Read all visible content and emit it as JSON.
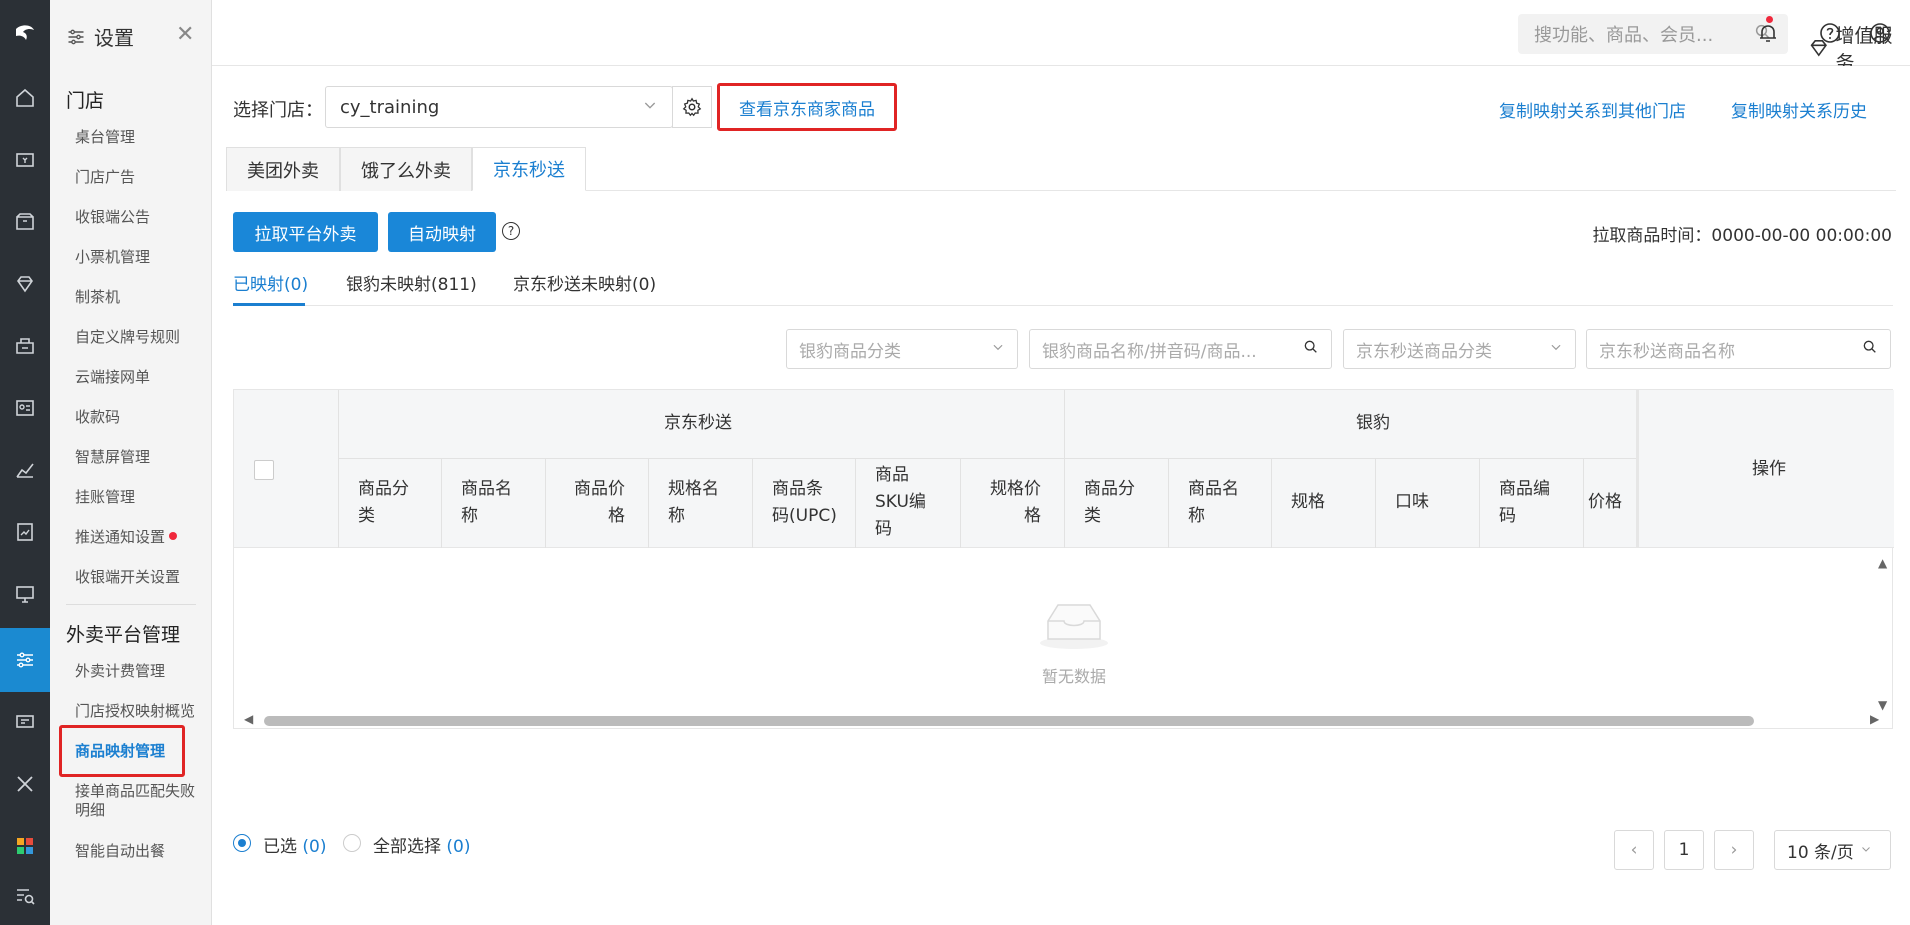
{
  "sidebar": {
    "title": "设置",
    "groups": [
      {
        "label": "门店",
        "items": [
          "桌台管理",
          "门店广告",
          "收银端公告",
          "小票机管理",
          "制茶机",
          "自定义牌号规则",
          "云端接网单",
          "收款码",
          "智慧屏管理",
          "挂账管理",
          "推送通知设置",
          "收银端开关设置"
        ]
      },
      {
        "label": "外卖平台管理",
        "items": [
          "外卖计费管理",
          "门店授权映射概览",
          "商品映射管理",
          "接单商品匹配失败明细",
          "智能自动出餐"
        ]
      }
    ]
  },
  "topbar": {
    "search_placeholder": "搜功能、商品、会员...",
    "value_added": "增值服务"
  },
  "store": {
    "label": "选择门店：",
    "value": "cy_training",
    "view_jd_button": "查看京东商家商品",
    "copy_mapping": "复制映射关系到其他门店",
    "copy_history": "复制映射关系历史"
  },
  "tabs": [
    "美团外卖",
    "饿了么外卖",
    "京东秒送"
  ],
  "actions": {
    "pull": "拉取平台外卖",
    "auto_map": "自动映射",
    "pull_time_label": "拉取商品时间：0000-00-00 00:00:00"
  },
  "subtabs": [
    "已映射(0)",
    "银豹未映射(811)",
    "京东秒送未映射(0)"
  ],
  "filters": {
    "yb_category": "银豹商品分类",
    "yb_name": "银豹商品名称/拼音码/商品...",
    "jd_category": "京东秒送商品分类",
    "jd_name": "京东秒送商品名称"
  },
  "table": {
    "group_jd": "京东秒送",
    "group_yb": "银豹",
    "op": "操作",
    "jd_cols": [
      "商品分\n类",
      "商品名\n称",
      "商品价\n格",
      "规格名\n称",
      "商品条\n码(UPC)",
      "商品\nSKU编\n码",
      "规格价\n格"
    ],
    "yb_cols": [
      "商品分\n类",
      "商品名\n称",
      "规格",
      "口味",
      "商品编\n码",
      "价格"
    ],
    "empty": "暂无数据"
  },
  "footer": {
    "selected": "已选",
    "selected_count": "(0)",
    "select_all": "全部选择",
    "select_all_count": "(0)",
    "page": "1",
    "page_size": "10 条/页"
  }
}
